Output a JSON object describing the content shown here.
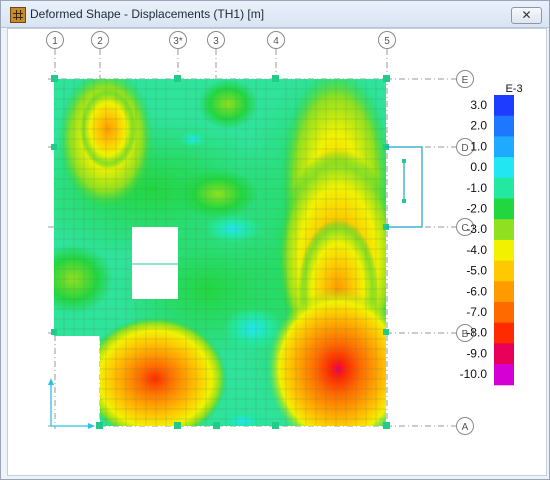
{
  "window": {
    "title": "Deformed Shape - Displacements (TH1)  [m]",
    "close_label": "✕"
  },
  "grid": {
    "columns": [
      "1",
      "2",
      "3*",
      "3",
      "4",
      "5"
    ],
    "rows": [
      "E",
      "D",
      "C",
      "B",
      "A"
    ]
  },
  "legend": {
    "title": "E-3",
    "labels": [
      "3.0",
      "2.0",
      "1.0",
      "0.0",
      "-1.0",
      "-2.0",
      "-3.0",
      "-4.0",
      "-5.0",
      "-6.0",
      "-7.0",
      "-8.0",
      "-9.0",
      "-10.0"
    ],
    "colors": [
      "#1e3cff",
      "#1e78ff",
      "#1eaaff",
      "#22e6f0",
      "#22e8a0",
      "#22d640",
      "#8ee020",
      "#f2f200",
      "#ffc800",
      "#ff9a00",
      "#ff6a00",
      "#ff2a00",
      "#e8005a",
      "#d400d4"
    ]
  },
  "colors": {
    "background_contour": "#2ee39a",
    "grid_line": "#7a8a6a",
    "support": "#22cc88",
    "bubble_stroke": "#7d7d7d"
  }
}
